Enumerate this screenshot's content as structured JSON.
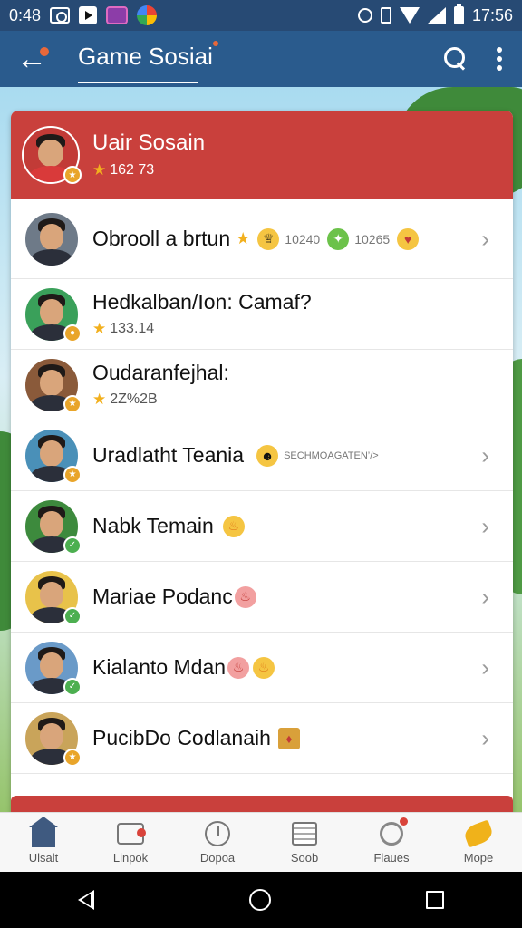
{
  "status_bar": {
    "time_left": "0:48",
    "time_right": "17:56"
  },
  "app_bar": {
    "title": "Game Sosiai"
  },
  "header_user": {
    "name": "Uair Sosain",
    "score": "162 73"
  },
  "rows": [
    {
      "name": "Obrooll a brtun",
      "extra_1": "10240",
      "extra_2": "10265",
      "badge_color": "#e9a52a"
    },
    {
      "name": "Hedkalban/Ion: Camaf?",
      "score": "133.14",
      "badge_color": "#e9a52a"
    },
    {
      "name": "Oudaranfejhal:",
      "score": "2Z%2B",
      "badge_color": "#e9a52a"
    },
    {
      "name": "Uradlatht Teania",
      "extra_1": "SECHMOAGATEN’/>",
      "badge_color": "#e9a52a"
    },
    {
      "name": "Nabk Temain",
      "badge_color": "#4caf50"
    },
    {
      "name": "Mariae Podanc",
      "badge_color": "#4caf50"
    },
    {
      "name": "Kialanto Mdan",
      "badge_color": "#4caf50"
    },
    {
      "name": "PucibDo Codlanaih",
      "badge_color": "#e9a52a"
    }
  ],
  "bottom_nav": [
    {
      "label": "Ulsalt",
      "icon": "home-icon"
    },
    {
      "label": "Linpok",
      "icon": "inbox-icon"
    },
    {
      "label": "Dopoa",
      "icon": "clock-icon"
    },
    {
      "label": "Soob",
      "icon": "news-icon"
    },
    {
      "label": "Flaues",
      "icon": "moon-icon"
    },
    {
      "label": "Mope",
      "icon": "leaf-icon"
    }
  ],
  "colors": {
    "status_bar": "#274a74",
    "app_bar": "#2a5b8d",
    "header_row": "#c9403c",
    "star": "#f2b01e"
  }
}
